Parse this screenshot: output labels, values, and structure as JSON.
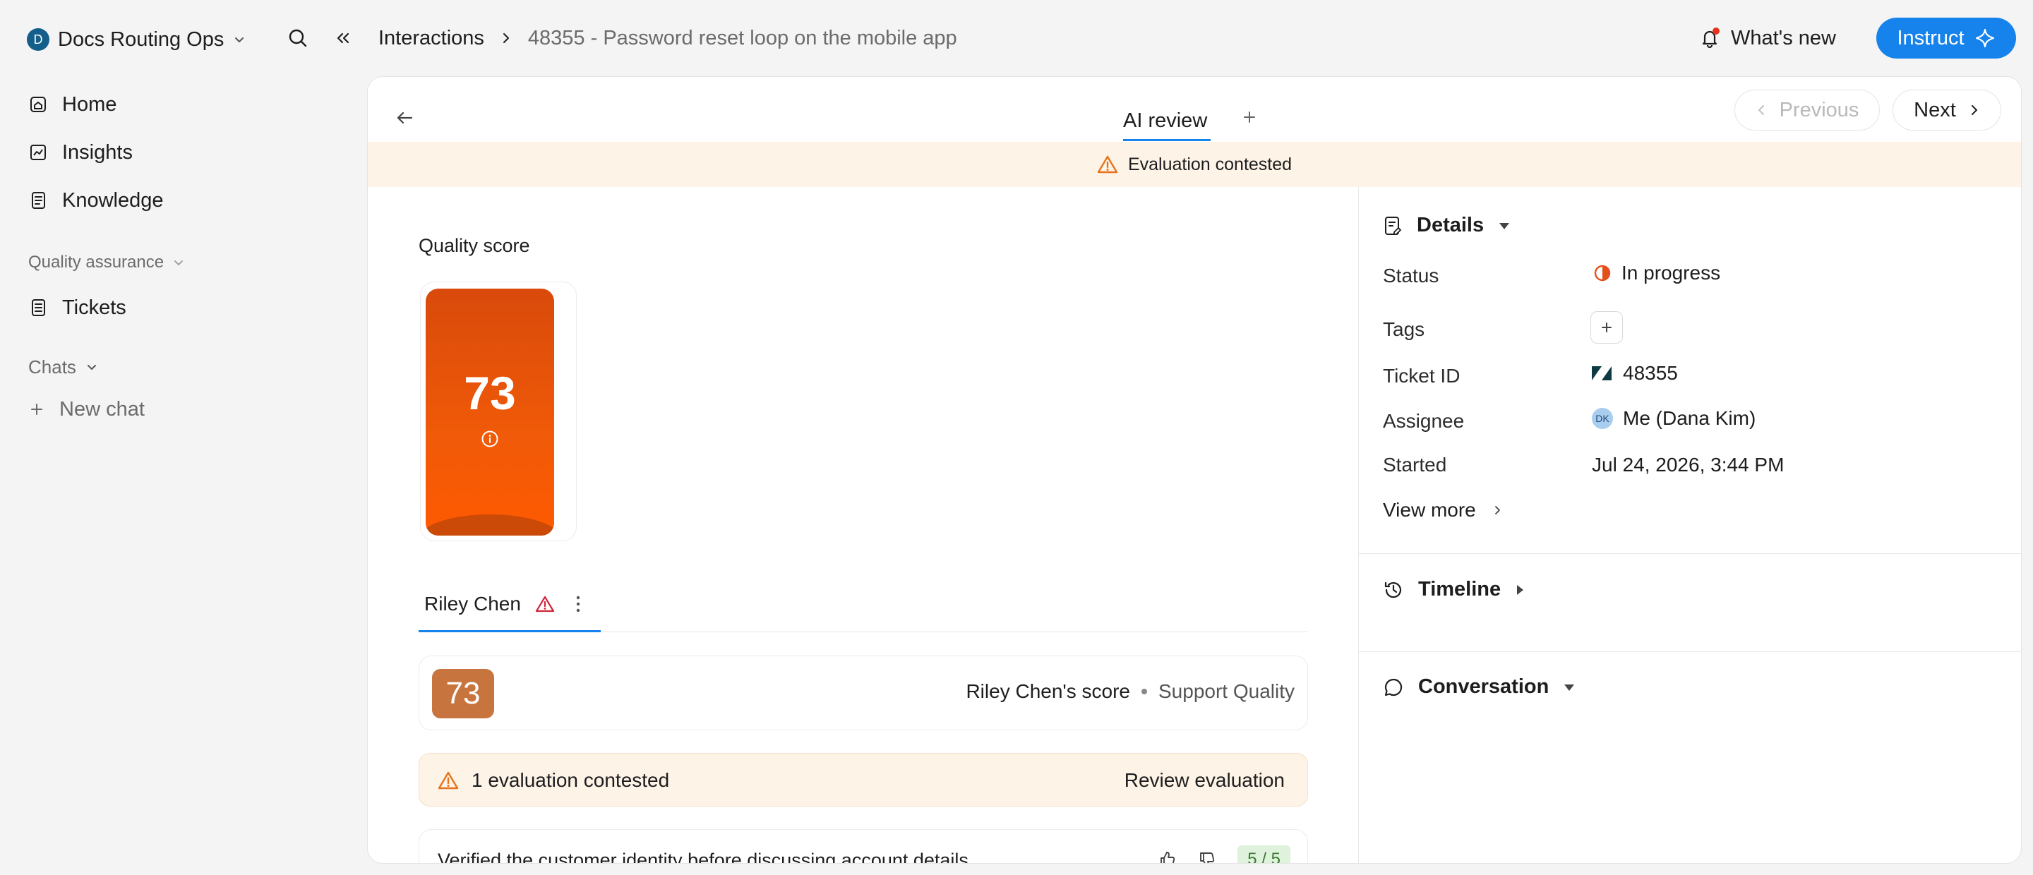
{
  "workspace": {
    "initial": "D",
    "name": "Docs Routing Ops"
  },
  "breadcrumb": {
    "section": "Interactions",
    "current": "48355 - Password reset loop on the mobile app"
  },
  "header": {
    "whats_new": "What's new",
    "instruct": "Instruct"
  },
  "sidebar": {
    "items": [
      {
        "label": "Home",
        "icon": "home-icon"
      },
      {
        "label": "Insights",
        "icon": "insights-icon"
      },
      {
        "label": "Knowledge",
        "icon": "book-icon"
      }
    ],
    "qa_section": "Quality assurance",
    "qa_items": [
      {
        "label": "Tickets",
        "icon": "ticket-icon"
      }
    ],
    "chats_section": "Chats",
    "new_chat": "New chat"
  },
  "panel": {
    "tab": "AI review",
    "previous": "Previous",
    "next": "Next",
    "banner": "Evaluation contested"
  },
  "quality": {
    "title": "Quality score",
    "score": "73",
    "agent": "Riley Chen",
    "card_score": "73",
    "card_who": "Riley Chen's score",
    "card_type": "Support Quality",
    "contest_text": "1 evaluation contested",
    "contest_link": "Review evaluation",
    "criterion": "Verified the customer identity before discussing account details",
    "criterion_score": "5 / 5"
  },
  "details": {
    "title": "Details",
    "status_label": "Status",
    "status_value": "In progress",
    "tags_label": "Tags",
    "ticket_label": "Ticket ID",
    "ticket_value": "48355",
    "assignee_label": "Assignee",
    "assignee_initials": "DK",
    "assignee_value": "Me (Dana Kim)",
    "started_label": "Started",
    "started_value": "Jul 24, 2026, 3:44 PM",
    "view_more": "View more"
  },
  "timeline": {
    "title": "Timeline"
  },
  "conversation": {
    "title": "Conversation"
  },
  "colors": {
    "accent": "#1683ec",
    "score_orange": "#f05a08",
    "warning": "#e8731a",
    "banner_bg": "#fdf3e7"
  }
}
